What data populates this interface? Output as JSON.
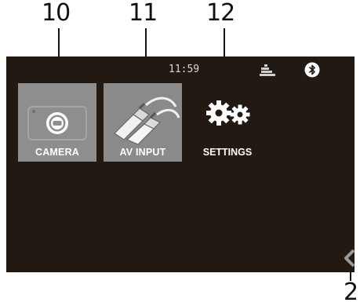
{
  "callouts": {
    "camera": "10",
    "av_input": "11",
    "settings": "12",
    "back": "2"
  },
  "status_bar": {
    "time": "11:59",
    "signal_icon": "signal-bars-icon",
    "bluetooth_icon": "bluetooth-icon"
  },
  "menu": {
    "camera_label": "CAMERA",
    "av_input_label": "AV INPUT",
    "settings_label": "SETTINGS"
  },
  "colors": {
    "screen_bg": "#221913",
    "tile_bg": "#8e8e8e",
    "text": "#ffffff"
  }
}
